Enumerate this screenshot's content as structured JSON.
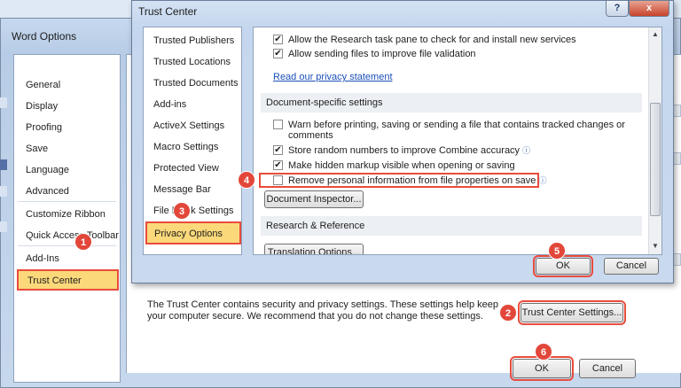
{
  "word_options": {
    "title": "Word Options",
    "sidebar": [
      "General",
      "Display",
      "Proofing",
      "Save",
      "Language",
      "Advanced",
      "Customize Ribbon",
      "Quick Access Toolbar",
      "Add-Ins",
      "Trust Center"
    ],
    "description": "The Trust Center contains security and privacy settings. These settings help keep your computer secure. We recommend that you do not change these settings.",
    "trust_center_settings_button": "Trust Center Settings...",
    "ok_button": "OK",
    "cancel_button": "Cancel"
  },
  "trust_center": {
    "title": "Trust Center",
    "help_icon": "?",
    "close_icon": "x",
    "sidebar": [
      "Trusted Publishers",
      "Trusted Locations",
      "Trusted Documents",
      "Add-ins",
      "ActiveX Settings",
      "Macro Settings",
      "Protected View",
      "Message Bar",
      "File Block Settings",
      "Privacy Options"
    ],
    "options": {
      "research_pane": "Allow the Research task pane to check for and install new services",
      "file_validation": "Allow sending files to improve file validation",
      "privacy_link": "Read our privacy statement",
      "doc_section": "Document-specific settings",
      "warn_printing": "Warn before printing, saving or sending a file that contains tracked changes or comments",
      "store_random": "Store random numbers to improve Combine accuracy",
      "hidden_markup": "Make hidden markup visible when opening or saving",
      "remove_personal": "Remove personal information from file properties on save",
      "doc_inspector": "Document Inspector...",
      "research_section": "Research & Reference",
      "translation_options": "Translation Options..."
    },
    "ok_button": "OK",
    "cancel_button": "Cancel"
  },
  "badges": [
    "1",
    "2",
    "3",
    "4",
    "5",
    "6"
  ],
  "colors": {
    "highlight": "#e84c3d",
    "selected_bg": "#fbd87a",
    "badge": "#e2473a"
  }
}
